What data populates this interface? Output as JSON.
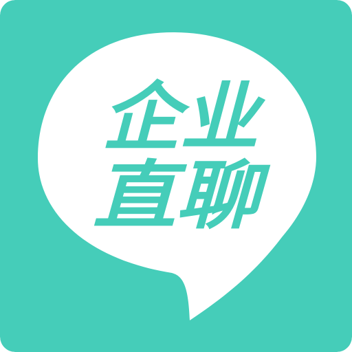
{
  "app_icon": {
    "name": "企业直聊",
    "line1": "企业",
    "line2": "直聊"
  },
  "colors": {
    "background": "#45CDB9",
    "bubble": "#FFFFFF",
    "text": "#45CDB9"
  }
}
